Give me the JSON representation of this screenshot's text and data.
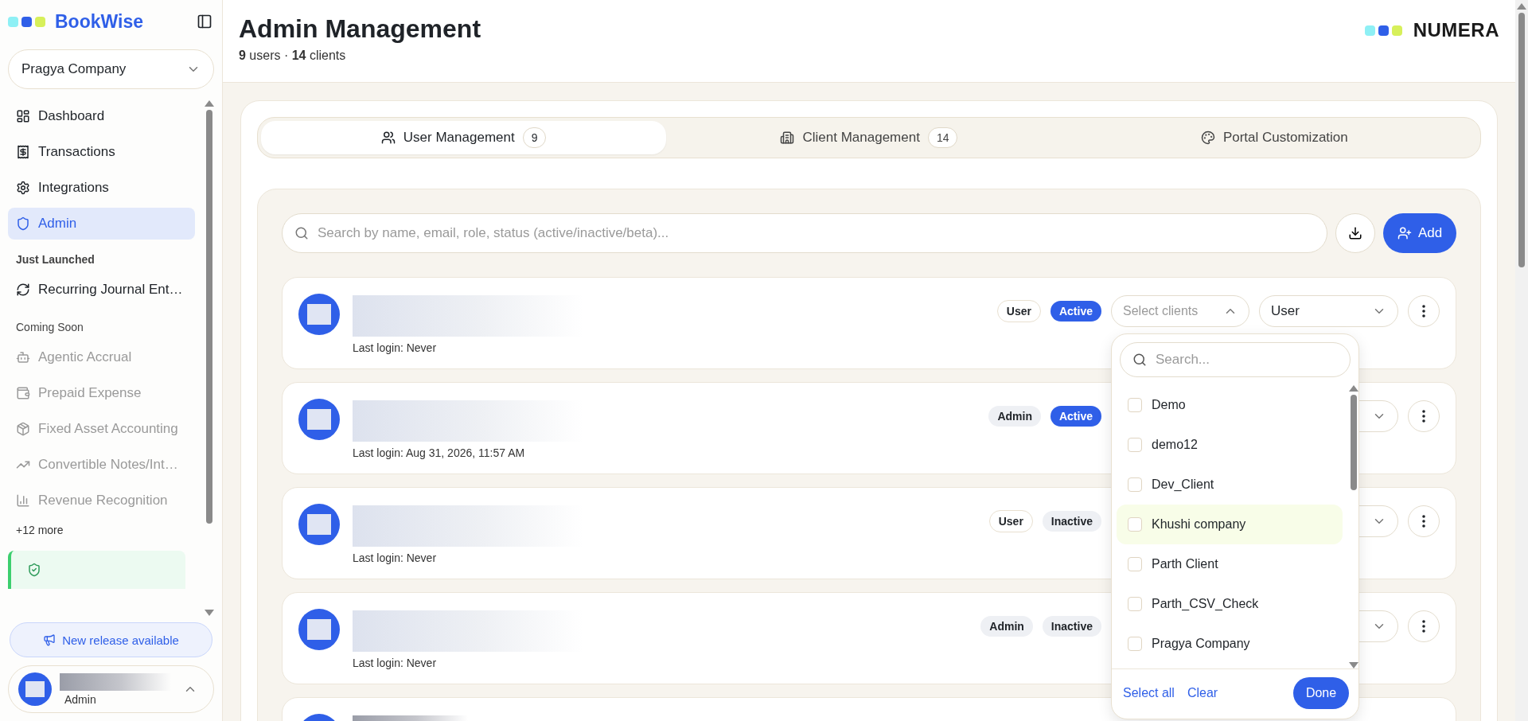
{
  "sidebar": {
    "brand": "BookWise",
    "company": "Pragya Company",
    "items": [
      {
        "kind": "link",
        "label": "Dashboard",
        "selected": false,
        "disabled": false
      },
      {
        "kind": "link",
        "label": "Transactions",
        "selected": false,
        "disabled": false
      },
      {
        "kind": "link",
        "label": "Integrations",
        "selected": false,
        "disabled": false
      },
      {
        "kind": "link",
        "label": "Admin",
        "selected": true,
        "disabled": false
      },
      {
        "kind": "heading",
        "label": "Just Launched"
      },
      {
        "kind": "link",
        "label": "Recurring Journal Ent…",
        "selected": false,
        "disabled": false
      },
      {
        "kind": "subheading",
        "label": "Coming Soon"
      },
      {
        "kind": "link",
        "label": "Agentic Accrual",
        "selected": false,
        "disabled": true
      },
      {
        "kind": "link",
        "label": "Prepaid Expense",
        "selected": false,
        "disabled": true
      },
      {
        "kind": "link",
        "label": "Fixed Asset Accounting",
        "selected": false,
        "disabled": true
      },
      {
        "kind": "link",
        "label": "Convertible Notes/Int…",
        "selected": false,
        "disabled": true
      },
      {
        "kind": "link",
        "label": "Revenue Recognition",
        "selected": false,
        "disabled": true
      },
      {
        "kind": "more",
        "label": "+12 more"
      }
    ],
    "release_button": "New release available",
    "user_role": "Admin"
  },
  "header": {
    "title": "Admin Management",
    "subtitle": "**9** users · **14** clients",
    "logo": "NUMERA"
  },
  "tabs": [
    {
      "label": "User Management",
      "count": "9",
      "selected": true
    },
    {
      "label": "Client Management",
      "count": "14",
      "selected": false
    },
    {
      "label": "Portal Customization",
      "selected": false
    }
  ],
  "search": {
    "placeholder": "Search by name, email, role, status (active/inactive/beta)..."
  },
  "add_button": "Add",
  "users": [
    {
      "role": "User",
      "status": "Active",
      "active": true,
      "last_login": "Last login: Never",
      "clients_placeholder": "Select clients",
      "role_value": "User"
    },
    {
      "role": "Admin",
      "status": "Active",
      "active": true,
      "last_login": "Last login: Aug 31, 2026, 11:57 AM"
    },
    {
      "role": "User",
      "status": "Inactive",
      "active": false,
      "last_login": "Last login: Never"
    },
    {
      "role": "Admin",
      "status": "Inactive",
      "active": false,
      "last_login": "Last login: Never"
    }
  ],
  "client_dropdown": {
    "search_placeholder": "Search...",
    "options": [
      {
        "label": "Demo",
        "checked": false,
        "highlighted": false
      },
      {
        "label": "demo12",
        "checked": false,
        "highlighted": false
      },
      {
        "label": "Dev_Client",
        "checked": false,
        "highlighted": false
      },
      {
        "label": "Khushi company",
        "checked": false,
        "highlighted": true
      },
      {
        "label": "Parth Client",
        "checked": false,
        "highlighted": false
      },
      {
        "label": "Parth_CSV_Check",
        "checked": false,
        "highlighted": false
      },
      {
        "label": "Pragya Company",
        "checked": false,
        "highlighted": false
      }
    ],
    "select_all": "Select all",
    "clear": "Clear",
    "done": "Done"
  }
}
